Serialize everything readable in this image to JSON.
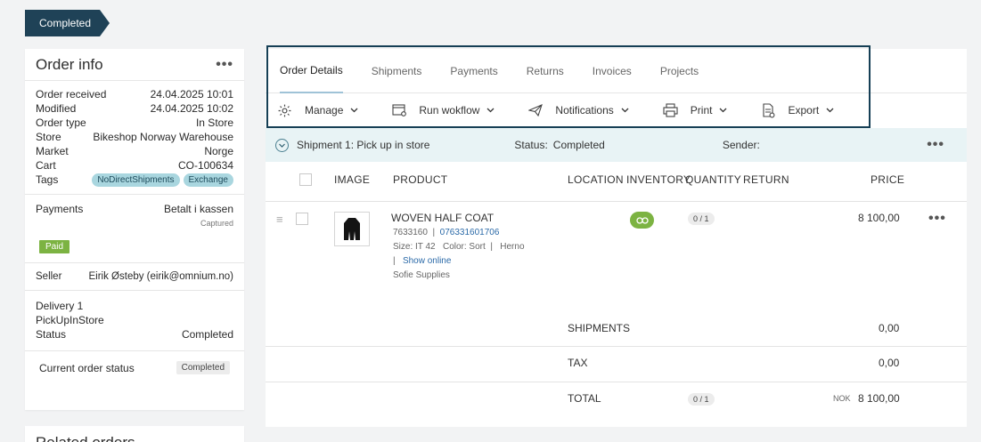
{
  "status_chip": "Completed",
  "order_info": {
    "title": "Order info",
    "rows": [
      {
        "label": "Order received",
        "value": "24.04.2025 10:01"
      },
      {
        "label": "Modified",
        "value": "24.04.2025 10:02"
      },
      {
        "label": "Order type",
        "value": "In Store"
      },
      {
        "label": "Store",
        "value": "Bikeshop Norway Warehouse"
      },
      {
        "label": "Market",
        "value": "Norge"
      },
      {
        "label": "Cart",
        "value": "CO-100634"
      }
    ],
    "tags_label": "Tags",
    "tags": [
      "NoDirectShipments",
      "Exchange"
    ],
    "payments_label": "Payments",
    "payments_value": "Betalt i kassen",
    "payments_sub": "Captured",
    "paid_badge": "Paid",
    "seller_label": "Seller",
    "seller_value": "Eirik Østeby (eirik@omnium.no)",
    "delivery_title": "Delivery 1",
    "delivery_type": "PickUpInStore",
    "delivery_status_label": "Status",
    "delivery_status_value": "Completed",
    "current_status_label": "Current order status",
    "current_status_value": "Completed"
  },
  "related_orders_title": "Related orders",
  "tabs": [
    "Order Details",
    "Shipments",
    "Payments",
    "Returns",
    "Invoices",
    "Projects"
  ],
  "toolbar": {
    "manage": "Manage",
    "run_workflow": "Run wokflow",
    "notifications": "Notifications",
    "print": "Print",
    "export": "Export"
  },
  "shipment": {
    "title": "Shipment 1: Pick up in store",
    "status_label": "Status:",
    "status_value": "Completed",
    "sender_label": "Sender:"
  },
  "columns": {
    "image": "IMAGE",
    "product": "PRODUCT",
    "location": "LOCATION",
    "inventory": "INVENTORY",
    "quantity": "QUANTITY",
    "return": "RETURN",
    "price": "PRICE"
  },
  "product": {
    "name": "WOVEN HALF COAT",
    "sku": "7633160",
    "ean": "076331601706",
    "size": "Size: IT 42",
    "color": "Color: Sort",
    "brand": "Herno",
    "show_online": "Show online",
    "supplier": "Sofie Supplies",
    "quantity": "0 / 1",
    "price": "8 100,00"
  },
  "totals": {
    "shipments_label": "SHIPMENTS",
    "shipments_value": "0,00",
    "tax_label": "TAX",
    "tax_value": "0,00",
    "total_label": "TOTAL",
    "total_qty": "0 / 1",
    "currency": "NOK",
    "total_value": "8 100,00"
  }
}
